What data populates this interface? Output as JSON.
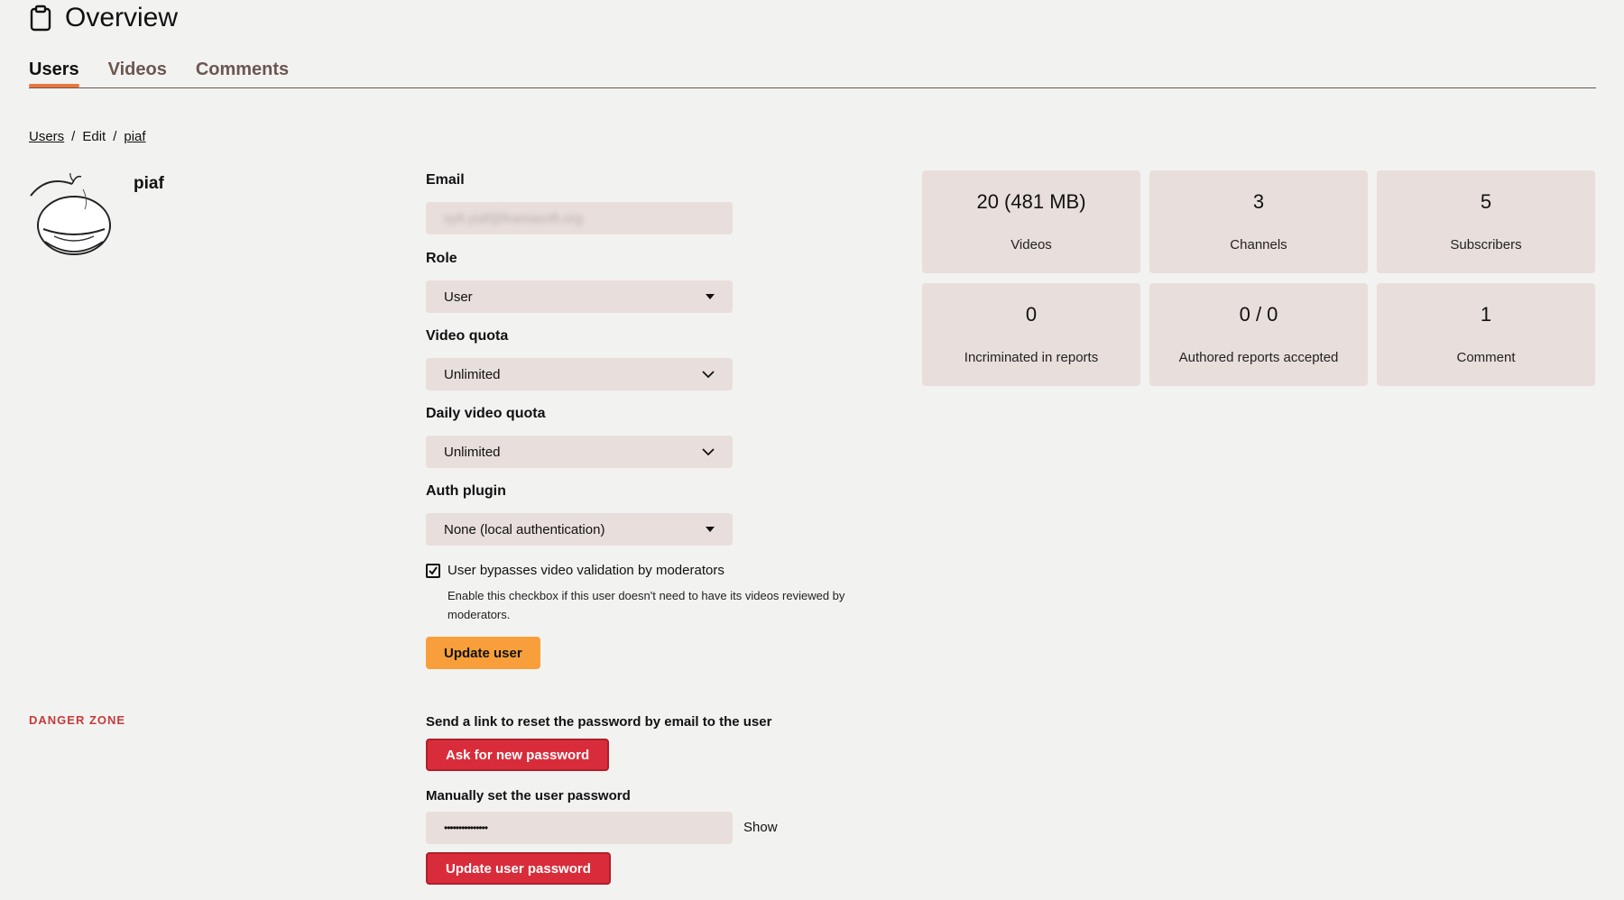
{
  "header": {
    "title": "Overview",
    "icon": "clipboard-icon"
  },
  "tabs": [
    {
      "label": "Users",
      "active": true
    },
    {
      "label": "Videos",
      "active": false
    },
    {
      "label": "Comments",
      "active": false
    }
  ],
  "breadcrumb": [
    "Users",
    "Edit",
    "piaf"
  ],
  "user": {
    "name": "piaf"
  },
  "form": {
    "email_label": "Email",
    "email_value": "sylt.yiaf@framasoft.org",
    "role_label": "Role",
    "role_value": "User",
    "video_quota_label": "Video quota",
    "video_quota_value": "Unlimited",
    "daily_quota_label": "Daily video quota",
    "daily_quota_value": "Unlimited",
    "auth_plugin_label": "Auth plugin",
    "auth_plugin_value": "None (local authentication)",
    "bypass_checkbox_label": "User bypasses video validation by moderators",
    "bypass_checked": true,
    "bypass_help": "Enable this checkbox if this user doesn't need to have its videos reviewed by moderators.",
    "update_button": "Update user"
  },
  "danger_zone": {
    "title": "DANGER ZONE",
    "reset_label": "Send a link to reset the password by email to the user",
    "ask_button": "Ask for new password",
    "manual_label": "Manually set the user password",
    "password_value": "•••••••••••••••",
    "show_label": "Show",
    "update_password_button": "Update user password"
  },
  "stats": [
    {
      "value": "20 (481 MB)",
      "label": "Videos"
    },
    {
      "value": "3",
      "label": "Channels"
    },
    {
      "value": "5",
      "label": "Subscribers"
    },
    {
      "value": "0",
      "label": "Incriminated in reports"
    },
    {
      "value": "0 / 0",
      "label": "Authored reports accepted"
    },
    {
      "value": "1",
      "label": "Comment"
    }
  ],
  "colors": {
    "accent": "#e9763a",
    "primary_button": "#f89f3b",
    "danger": "#d92c3a",
    "field_bg": "#e8dedb",
    "page_bg": "#f2f2f1"
  }
}
